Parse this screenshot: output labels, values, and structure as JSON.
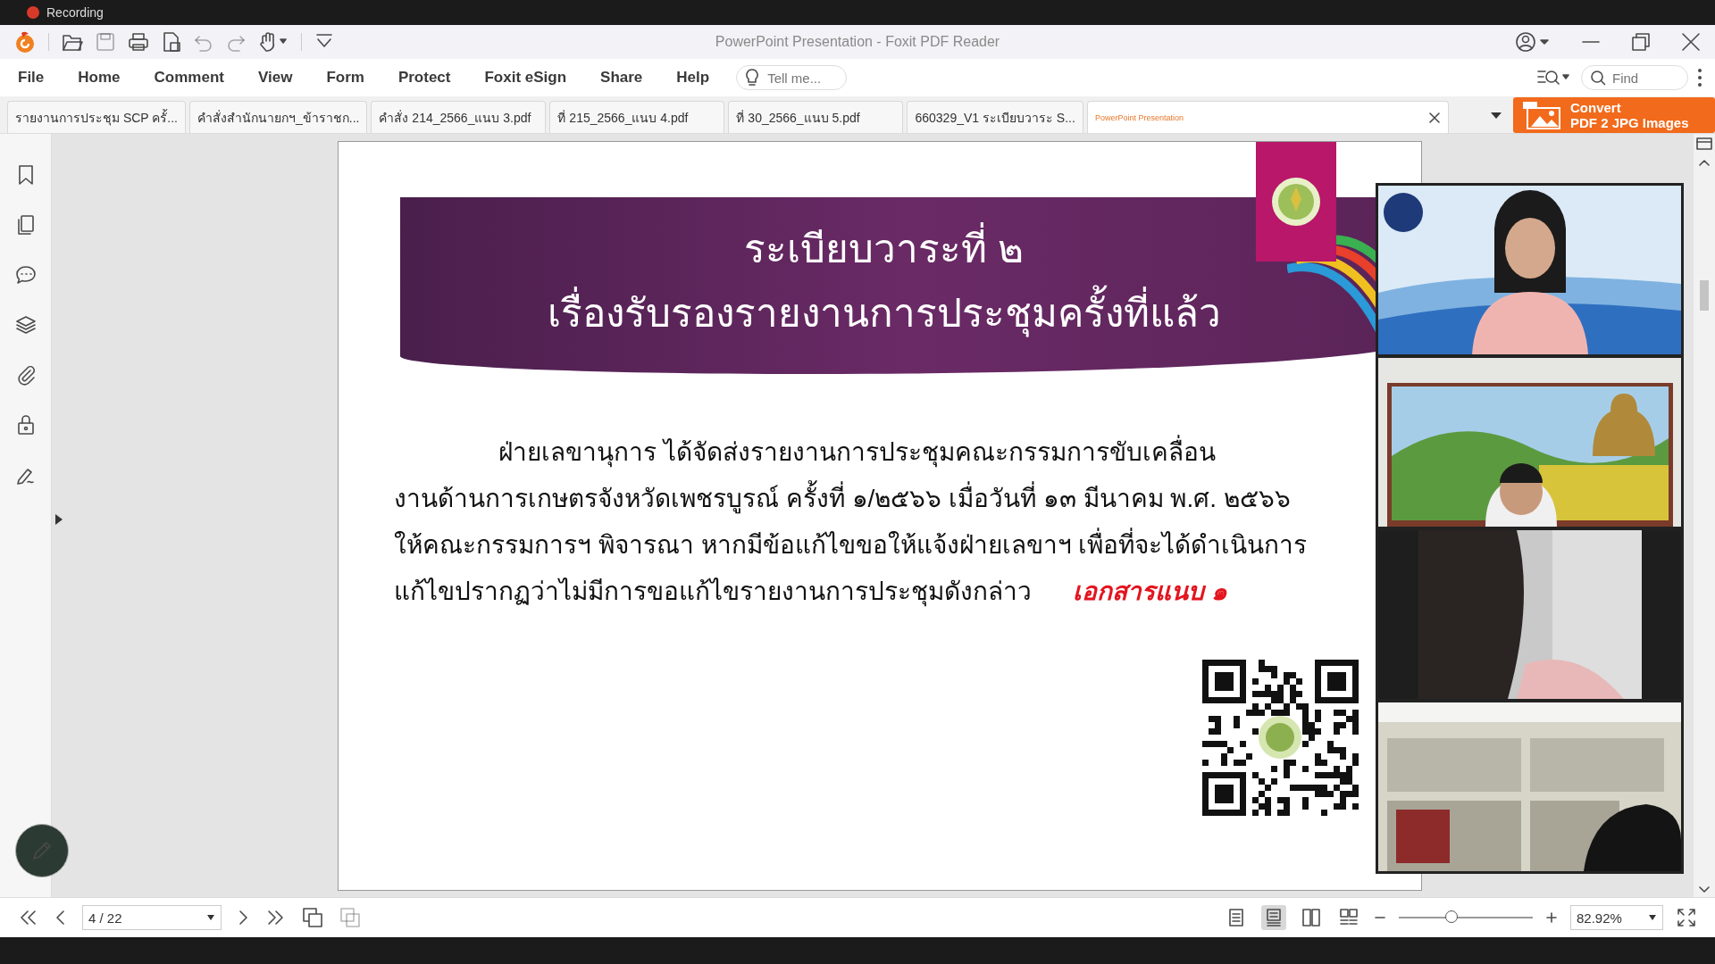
{
  "recording": {
    "label": "Recording"
  },
  "window": {
    "title": "PowerPoint Presentation - Foxit PDF Reader"
  },
  "menu": [
    "File",
    "Home",
    "Comment",
    "View",
    "Form",
    "Protect",
    "Foxit eSign",
    "Share",
    "Help"
  ],
  "tell_me": {
    "placeholder": "Tell me..."
  },
  "find": {
    "placeholder": "Find"
  },
  "tabs": [
    {
      "label": "รายงานการประชุม SCP ครั้...",
      "selected": false
    },
    {
      "label": "คำสั่งสำนักนายกฯ_ข้าราชก...",
      "selected": false
    },
    {
      "label": "คำสั่ง 214_2566_แนบ 3.pdf",
      "selected": false
    },
    {
      "label": "ที่ 215_2566_แนบ 4.pdf",
      "selected": false
    },
    {
      "label": "ที่ 30_2566_แนบ 5.pdf",
      "selected": false
    },
    {
      "label": "660329_V1 ระเบียบวาระ S...",
      "selected": false
    },
    {
      "label": "PowerPoint Presentation",
      "selected": true
    }
  ],
  "convert_button": {
    "line1": "Convert",
    "line2": "PDF 2 JPG Images"
  },
  "slide": {
    "title_lines": [
      "ระเบียบวาระที่ ๒",
      "เรื่องรับรองรายงานการประชุมครั้งที่แล้ว"
    ],
    "body_lines": [
      "ฝ่ายเลขานุการ  ได้จัดส่งรายงานการประชุมคณะกรรมการขับเคลื่อน",
      "งานด้านการเกษตรจังหวัดเพชรบูรณ์ ครั้งที่ ๑/๒๕๖๖  เมื่อวันที่ ๑๓ มีนาคม พ.ศ. ๒๕๖๖",
      "ให้คณะกรรมการฯ พิจารณา หากมีข้อแก้ไขขอให้แจ้งฝ่ายเลขาฯ เพื่อที่จะได้ดำเนินการ",
      "แก้ไขปรากฏว่าไม่มีการขอแก้ไขรายงานการประชุมดังกล่าว"
    ],
    "attachment": "เอกสารแนบ ๑"
  },
  "page_nav": {
    "page": "4 / 22"
  },
  "view_modes": [
    {
      "selected": false
    },
    {
      "selected": true
    },
    {
      "selected": false
    },
    {
      "selected": false
    }
  ],
  "zoom": {
    "value": "82.92%",
    "level": 0.4
  }
}
